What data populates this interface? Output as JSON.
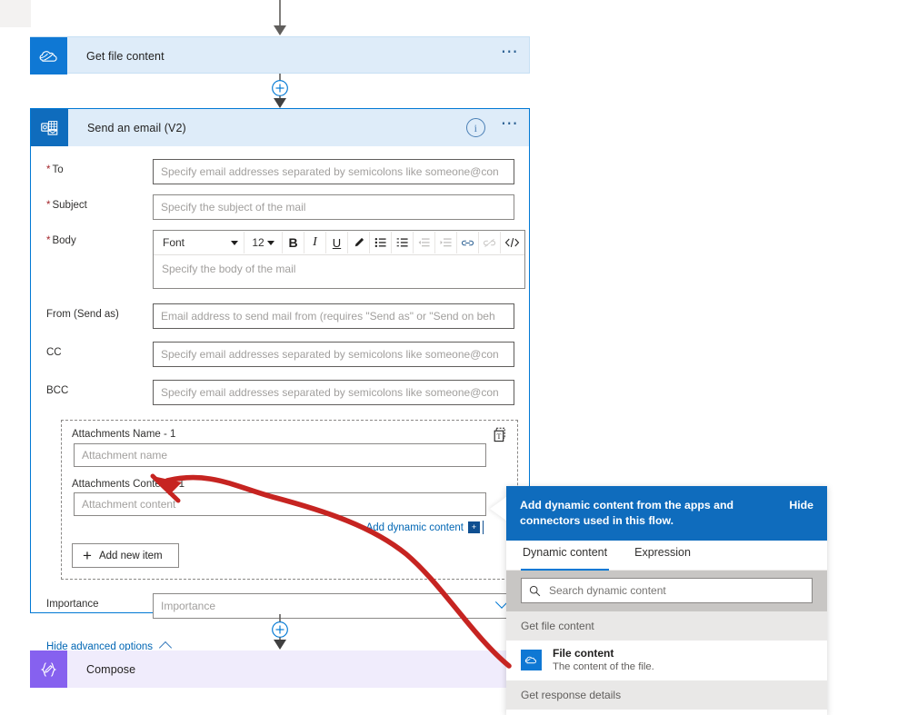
{
  "flow": {
    "nodes": [
      {
        "id": "get-file-content",
        "title": "Get file content",
        "icon": "onedrive-icon",
        "color": "#0f78d4"
      },
      {
        "id": "send-an-email-v2",
        "title": "Send an email (V2)",
        "icon": "outlook-icon",
        "color": "#0f6cbd"
      },
      {
        "id": "compose",
        "title": "Compose",
        "icon": "compose-braces-icon",
        "color": "#8661ef"
      }
    ],
    "add_step_tooltip": "+"
  },
  "email_card": {
    "title": "Send an email (V2)",
    "fields": {
      "to": {
        "label": "To",
        "required": true,
        "placeholder": "Specify email addresses separated by semicolons like someone@con"
      },
      "subject": {
        "label": "Subject",
        "required": true,
        "placeholder": "Specify the subject of the mail"
      },
      "body": {
        "label": "Body",
        "required": true,
        "placeholder": "Specify the body of the mail"
      },
      "from": {
        "label": "From (Send as)",
        "required": false,
        "placeholder": "Email address to send mail from (requires \"Send as\" or \"Send on beh"
      },
      "cc": {
        "label": "CC",
        "required": false,
        "placeholder": "Specify email addresses separated by semicolons like someone@con"
      },
      "bcc": {
        "label": "BCC",
        "required": false,
        "placeholder": "Specify email addresses separated by semicolons like someone@con"
      },
      "importance": {
        "label": "Importance",
        "placeholder": "Importance"
      }
    },
    "rte": {
      "font_name": "Font",
      "font_size": "12",
      "buttons": [
        "B",
        "I",
        "U"
      ]
    },
    "attachments": {
      "name_label": "Attachments Name - 1",
      "name_placeholder": "Attachment name",
      "content_label": "Attachments Content - 1",
      "content_placeholder": "Attachment content",
      "add_dynamic_content": "Add dynamic content",
      "add_new_item": "Add new item"
    },
    "advanced_toggle": "Hide advanced options"
  },
  "dynamic_panel": {
    "header": "Add dynamic content from the apps and connectors used in this flow.",
    "hide_label": "Hide",
    "tabs": [
      {
        "label": "Dynamic content",
        "active": true
      },
      {
        "label": "Expression",
        "active": false
      }
    ],
    "search_placeholder": "Search dynamic content",
    "groups": [
      {
        "name": "Get file content",
        "items": [
          {
            "name": "File content",
            "description": "The content of the file.",
            "icon": "onedrive-icon"
          }
        ]
      },
      {
        "name": "Get response details",
        "items": []
      }
    ]
  },
  "annotation": {
    "type": "red-arrow",
    "color": "#c62421",
    "from": "File content item in dynamic content panel",
    "to": "Attachment content field"
  }
}
